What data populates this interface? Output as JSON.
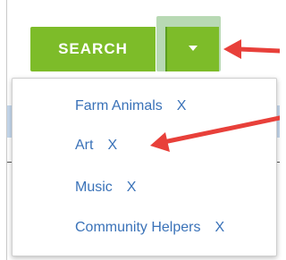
{
  "search_button": {
    "label": "SEARCH"
  },
  "dropdown_toggle": {
    "icon": "caret-down-icon"
  },
  "filter_menu": {
    "items": [
      {
        "label": "Farm Animals",
        "remove": "X"
      },
      {
        "label": "Art",
        "remove": "X"
      },
      {
        "label": "Music",
        "remove": "X"
      },
      {
        "label": "Community Helpers",
        "remove": "X"
      }
    ]
  },
  "annotations": {
    "arrow_color": "#e8403a"
  },
  "colors": {
    "accent_green": "#7dbc29",
    "link_blue": "#3a72b8"
  }
}
